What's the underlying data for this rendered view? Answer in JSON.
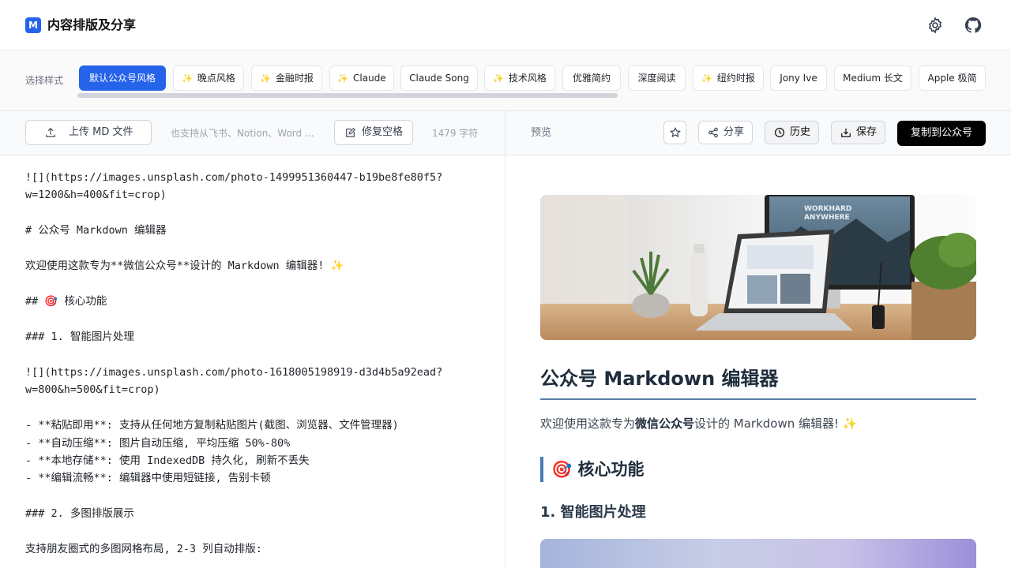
{
  "header": {
    "logo_letter": "M",
    "title": "内容排版及分享",
    "icons": [
      "gear-icon",
      "github-icon"
    ]
  },
  "styles": {
    "label": "选择样式",
    "items": [
      {
        "label": "默认公众号风格",
        "active": true,
        "sparkle": false
      },
      {
        "label": "晚点风格",
        "active": false,
        "sparkle": true
      },
      {
        "label": "金融时报",
        "active": false,
        "sparkle": true
      },
      {
        "label": "Claude",
        "active": false,
        "sparkle": true
      },
      {
        "label": "Claude Song",
        "active": false,
        "sparkle": false
      },
      {
        "label": "技术风格",
        "active": false,
        "sparkle": true
      },
      {
        "label": "优雅简约",
        "active": false,
        "sparkle": false
      },
      {
        "label": "深度阅读",
        "active": false,
        "sparkle": false
      },
      {
        "label": "纽约时报",
        "active": false,
        "sparkle": true
      },
      {
        "label": "Jony Ive",
        "active": false,
        "sparkle": false
      },
      {
        "label": "Medium 长文",
        "active": false,
        "sparkle": false
      },
      {
        "label": "Apple 极简",
        "active": false,
        "sparkle": false
      }
    ]
  },
  "toolbar": {
    "upload_label": "上传 MD 文件",
    "upload_hint": "也支持从飞书、Notion、Word ...",
    "fix_spaces_label": "修复空格",
    "char_count": "1479 字符",
    "preview_label": "预览",
    "share_label": "分享",
    "history_label": "历史",
    "save_label": "保存",
    "copy_label": "复制到公众号"
  },
  "editor": {
    "lines": [
      "![](https://images.unsplash.com/photo-1499951360447-b19be8fe80f5?",
      "w=1200&h=400&fit=crop)",
      "",
      "# 公众号 Markdown 编辑器",
      "",
      "欢迎使用这款专为**微信公众号**设计的 Markdown 编辑器! ✨",
      "",
      "## 🎯 核心功能",
      "",
      "### 1. 智能图片处理",
      "",
      "![](https://images.unsplash.com/photo-1618005198919-d3d4b5a92ead?",
      "w=800&h=500&fit=crop)",
      "",
      "- **粘贴即用**: 支持从任何地方复制粘贴图片(截图、浏览器、文件管理器)",
      "- **自动压缩**: 图片自动压缩, 平均压缩 50%-80%",
      "- **本地存储**: 使用 IndexedDB 持久化, 刷新不丢失",
      "- **编辑流畅**: 编辑器中使用短链接, 告别卡顿",
      "",
      "### 2. 多图排版展示",
      "",
      "支持朋友圈式的多图网格布局, 2-3 列自动排版:"
    ]
  },
  "preview": {
    "h1": "公众号 Markdown 编辑器",
    "p_before": "欢迎使用这款专为",
    "p_bold": "微信公众号",
    "p_after": "设计的 Markdown 编辑器! ✨",
    "h2": "🎯 核心功能",
    "h3": "1. 智能图片处理",
    "hero_text": "WORKHARD ANYWHERE"
  },
  "colors": {
    "accent": "#2563eb",
    "sparkle": "#f5b400",
    "heading_rule": "#5b7fa6"
  }
}
